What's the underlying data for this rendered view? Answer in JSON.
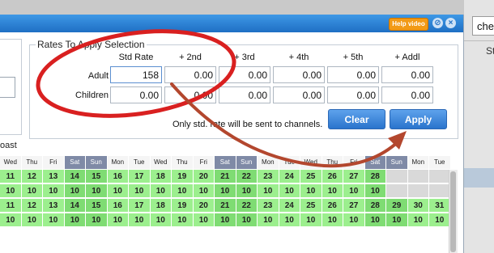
{
  "background": {
    "search_text": "che",
    "column_header": "Std"
  },
  "dialog": {
    "help_label": "Help video",
    "minimize_icon": "minimize-icon",
    "close_icon": "close-icon",
    "left_label": "oast",
    "legend": "Rates To Apply Selection",
    "columns": [
      "Std Rate",
      "+ 2nd",
      "+ 3rd",
      "+ 4th",
      "+ 5th",
      "+ Addl"
    ],
    "rows": [
      {
        "label": "Adult",
        "values": [
          "158",
          "0.00",
          "0.00",
          "0.00",
          "0.00",
          "0.00"
        ]
      },
      {
        "label": "Children",
        "values": [
          "0.00",
          "0.00",
          "0.00",
          "0.00",
          "0.00",
          "0.00"
        ]
      }
    ],
    "note": "Only std. rate will be sent to channels.",
    "clear_label": "Clear",
    "apply_label": "Apply"
  },
  "calendar": {
    "days": [
      "Wed",
      "Thu",
      "Fri",
      "Sat",
      "Sun",
      "Mon",
      "Tue",
      "Wed",
      "Thu",
      "Fri",
      "Sat",
      "Sun",
      "Mon",
      "Tue",
      "Wed",
      "Thu",
      "Fri",
      "Sat",
      "Sun",
      "Mon",
      "Tue"
    ],
    "weekend_flags": [
      0,
      0,
      0,
      1,
      1,
      0,
      0,
      0,
      0,
      0,
      1,
      1,
      0,
      0,
      0,
      0,
      0,
      1,
      1,
      0,
      0
    ],
    "rows": [
      [
        "11",
        "12",
        "13",
        "14",
        "15",
        "16",
        "17",
        "18",
        "19",
        "20",
        "21",
        "22",
        "23",
        "24",
        "25",
        "26",
        "27",
        "28",
        "",
        "",
        ""
      ],
      [
        "10",
        "10",
        "10",
        "10",
        "10",
        "10",
        "10",
        "10",
        "10",
        "10",
        "10",
        "10",
        "10",
        "10",
        "10",
        "10",
        "10",
        "10",
        "",
        "",
        ""
      ],
      [
        "11",
        "12",
        "13",
        "14",
        "15",
        "16",
        "17",
        "18",
        "19",
        "20",
        "21",
        "22",
        "23",
        "24",
        "25",
        "26",
        "27",
        "28",
        "29",
        "30",
        "31"
      ],
      [
        "10",
        "10",
        "10",
        "10",
        "10",
        "10",
        "10",
        "10",
        "10",
        "10",
        "10",
        "10",
        "10",
        "10",
        "10",
        "10",
        "10",
        "10",
        "10",
        "10",
        "10"
      ]
    ]
  },
  "colors": {
    "title_bar": "#2a7fd6",
    "apply_button": "#2a74cc",
    "annotation": "#d92020",
    "arrow": "#b3472e",
    "available": "#9cef8e",
    "weekend_header": "#7f8aa6"
  }
}
